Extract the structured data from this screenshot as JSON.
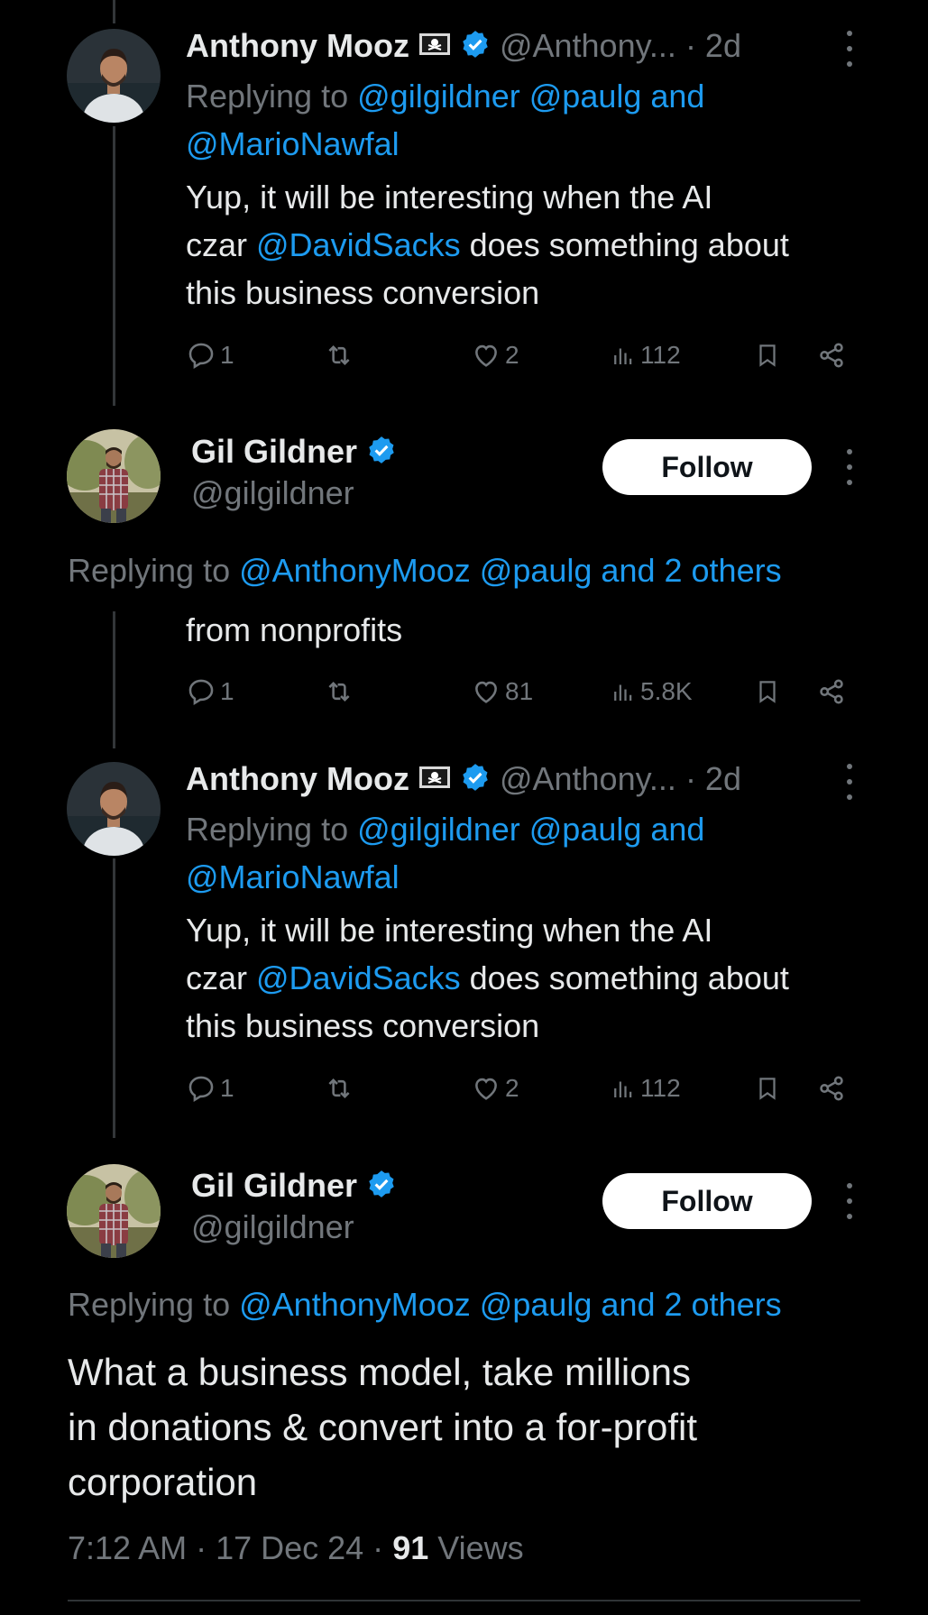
{
  "tweets": [
    {
      "kind": "compact",
      "author": "Anthony Mooz",
      "flag_icon": "pirate-flag-icon",
      "handle": "@Anthony...",
      "time": "· 2d",
      "reply_prefix": "Replying to",
      "reply_users": "@gilgildner @paulg and",
      "reply_users_2": "@MarioNawfal",
      "text_1": "Yup, it will be interesting when the AI",
      "text_2_pre": "czar ",
      "text_2_link": "@DavidSacks",
      "text_2_post": " does something about",
      "text_3": "this business conversion",
      "stats": {
        "replies": "1",
        "reposts": "",
        "likes": "2",
        "views": "112"
      }
    },
    {
      "kind": "expanded",
      "author": "Gil Gildner",
      "handle": "@gilgildner",
      "follow_label": "Follow",
      "reply_prefix": "Replying to",
      "reply_users": "@AnthonyMooz @paulg and 2 others",
      "text": "from nonprofits",
      "stats": {
        "replies": "1",
        "reposts": "",
        "likes": "81",
        "views": "5.8K"
      }
    },
    {
      "kind": "compact",
      "author": "Anthony Mooz",
      "flag_icon": "pirate-flag-icon",
      "handle": "@Anthony...",
      "time": "· 2d",
      "reply_prefix": "Replying to",
      "reply_users": "@gilgildner @paulg and",
      "reply_users_2": "@MarioNawfal",
      "text_1": "Yup, it will be interesting when the AI",
      "text_2_pre": "czar ",
      "text_2_link": "@DavidSacks",
      "text_2_post": " does something about",
      "text_3": "this business conversion",
      "stats": {
        "replies": "1",
        "reposts": "",
        "likes": "2",
        "views": "112"
      }
    },
    {
      "kind": "main",
      "author": "Gil Gildner",
      "handle": "@gilgildner",
      "follow_label": "Follow",
      "reply_prefix": "Replying to",
      "reply_users": "@AnthonyMooz @paulg and 2 others",
      "text_1": "What a business model, take millions",
      "text_2": "in donations & convert into a for-profit",
      "text_3": "corporation",
      "meta_time": "7:12 AM · 17 Dec 24 · ",
      "meta_views": "91",
      "meta_views_label": " Views"
    }
  ],
  "colors": {
    "accent": "#1d9bf0",
    "muted": "#71767b",
    "text": "#e7e9ea",
    "background": "#000000"
  }
}
